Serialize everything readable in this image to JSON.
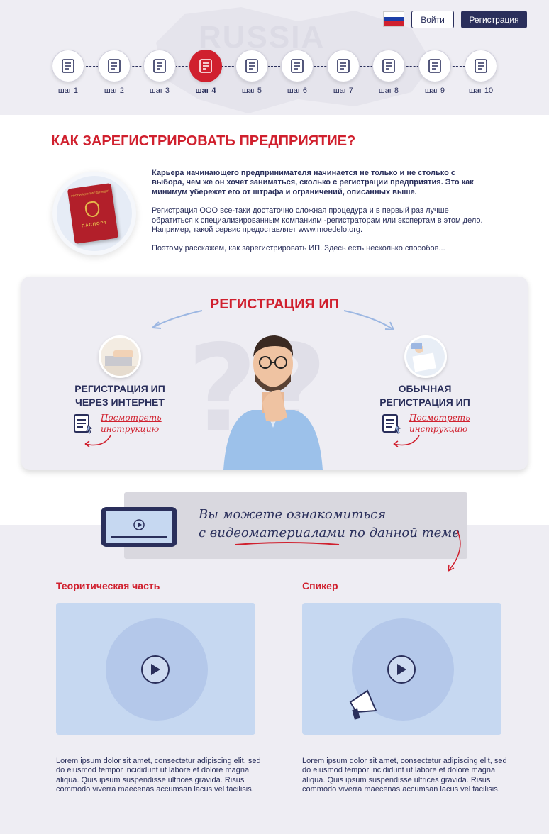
{
  "header": {
    "watermark": "RUSSIA",
    "login_label": "Войти",
    "register_label": "Регистрация",
    "flag_colors": [
      "#ffffff",
      "#1c3fa8",
      "#d0202e"
    ],
    "steps": [
      {
        "label": "шаг 1",
        "icon": "lightbulb-icon",
        "active": false
      },
      {
        "label": "шаг 2",
        "icon": "box-icon",
        "active": false
      },
      {
        "label": "шаг 3",
        "icon": "checklist-icon",
        "active": false
      },
      {
        "label": "шаг 4",
        "icon": "calculator-icon",
        "active": true
      },
      {
        "label": "шаг 5",
        "icon": "money-bag-icon",
        "active": false
      },
      {
        "label": "шаг 6",
        "icon": "credit-card-icon",
        "active": false
      },
      {
        "label": "шаг 7",
        "icon": "workplace-icon",
        "active": false
      },
      {
        "label": "шаг 8",
        "icon": "devices-icon",
        "active": false
      },
      {
        "label": "шаг 9",
        "icon": "megaphone-icon",
        "active": false
      },
      {
        "label": "шаг 10",
        "icon": "badge-icon",
        "active": false
      }
    ]
  },
  "intro": {
    "title": "КАК ЗАРЕГИСТРИРОВАТЬ ПРЕДПРИЯТИЕ?",
    "passport_label": "ПАСПОРТ",
    "passport_top": "РОССИЙСКАЯ ФЕДЕРАЦИЯ",
    "p1": "Карьера начинающего предпринимателя начинается не только и не столько с выбора, чем же он хочет заниматься, сколько с регистрации предприятия. Это как минимум убережет его от штрафа и ограничений, описанных выше.",
    "p2_before": "Регистрация ООО все-таки достаточно сложная процедура и в первый раз лучше обратиться к специализированным компаниям -регистраторам или экспертам в этом дело. Например, такой сервис предоставляет ",
    "p2_link": "www.moedelo.org.",
    "p3": "Поэтому расскажем, как зарегистрировать ИП. Здесь есть несколько способов..."
  },
  "registration": {
    "title": "РЕГИСТРАЦИЯ ИП",
    "left": {
      "line1": "РЕГИСТРАЦИЯ ИП",
      "line2": "ЧЕРЕЗ ИНТЕРНЕТ",
      "link1": "Посмотреть",
      "link2": "инструкцию"
    },
    "right": {
      "line1": "ОБЫЧНАЯ",
      "line2": "РЕГИСТРАЦИЯ ИП",
      "link1": "Посмотреть",
      "link2": "инструкцию"
    }
  },
  "video": {
    "banner_line1": "Вы можете ознакомиться",
    "banner_line2": "с видеоматериалами по данной теме",
    "col1_title": "Теоритическая часть",
    "col2_title": "Спикер",
    "lorem": "Lorem ipsum dolor sit amet, consectetur adipiscing elit, sed do eiusmod tempor incididunt ut labore et dolore magna aliqua. Quis ipsum suspendisse ultrices gravida. Risus commodo viverra maecenas accumsan lacus vel facilisis."
  }
}
